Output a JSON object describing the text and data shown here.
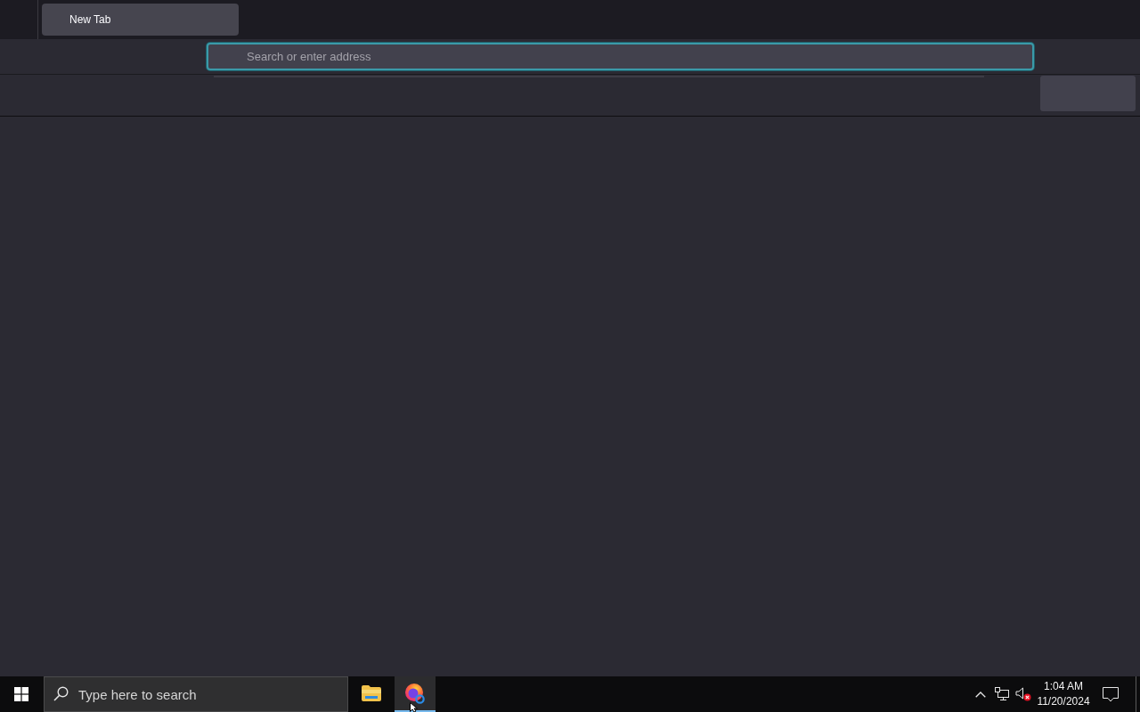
{
  "browser": {
    "tabs": [
      {
        "label": "New Tab",
        "selected": true
      }
    ],
    "address_bar": {
      "placeholder": "Search or enter address",
      "focused": true
    }
  },
  "taskbar": {
    "search": {
      "placeholder": "Type here to search"
    },
    "apps": [
      {
        "kind": "file-explorer",
        "active": false
      },
      {
        "kind": "browser",
        "active": true
      }
    ],
    "tray": {
      "volume_muted": true,
      "time": "1:04 AM",
      "date": "11/20/2024"
    }
  }
}
